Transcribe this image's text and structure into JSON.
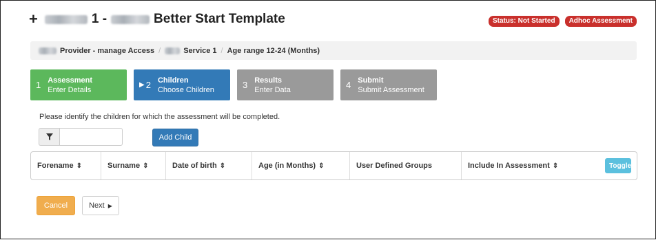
{
  "header": {
    "title_part1": "1 -",
    "title_part2": "Better Start Template",
    "badges": [
      "Status: Not Started",
      "Adhoc Assessment"
    ]
  },
  "breadcrumb": {
    "item1": "Provider - manage Access",
    "item2": "Service 1",
    "item3": "Age range 12-24 (Months)"
  },
  "steps": [
    {
      "num": "1",
      "title": "Assessment",
      "sub": "Enter Details"
    },
    {
      "num": "2",
      "title": "Children",
      "sub": "Choose Children"
    },
    {
      "num": "3",
      "title": "Results",
      "sub": "Enter Data"
    },
    {
      "num": "4",
      "title": "Submit",
      "sub": "Submit Assessment"
    }
  ],
  "instruction": "Please identify the children for which the assessment will be completed.",
  "filter": {
    "value": ""
  },
  "add_child_label": "Add Child",
  "table": {
    "columns": [
      "Forename",
      "Surname",
      "Date of birth",
      "Age (in Months)",
      "User Defined Groups",
      "Include In Assessment"
    ],
    "toggle_label": "Toggle"
  },
  "actions": {
    "cancel": "Cancel",
    "next": "Next"
  },
  "colors": {
    "green": "#5cb85c",
    "blue": "#337ab7",
    "grey": "#9a9a9a",
    "badge_red": "#c9302c",
    "cancel_orange": "#f0ad4e",
    "toggle_cyan": "#5bc0de"
  }
}
